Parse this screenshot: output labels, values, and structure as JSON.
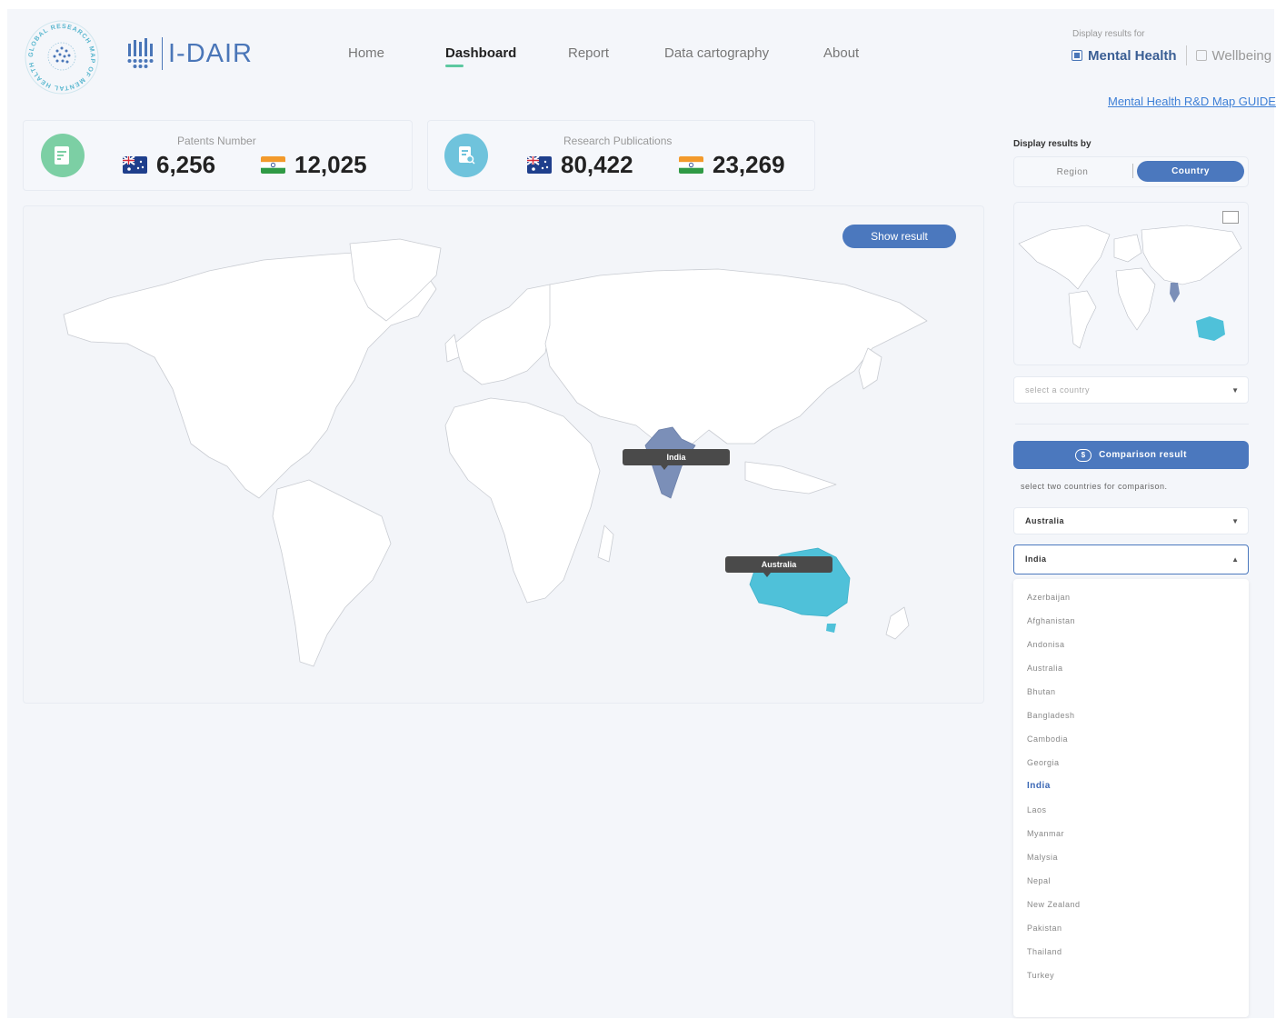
{
  "brand": {
    "name": "I-DAIR",
    "seal_text": "GLOBAL RESEARCH MAP OF MENTAL HEALTH"
  },
  "nav": {
    "items": [
      "Home",
      "Dashboard",
      "Report",
      "Data cartography",
      "About"
    ],
    "active": "Dashboard"
  },
  "display_for": {
    "label": "Display results for",
    "options": [
      {
        "label": "Mental Health",
        "checked": true
      },
      {
        "label": "Wellbeing",
        "checked": false
      }
    ]
  },
  "guide_link": "Mental Health R&D Map GUIDE",
  "stats": {
    "patents": {
      "label": "Patents Number",
      "australia": "6,256",
      "india": "12,025"
    },
    "publications": {
      "label": "Research Publications",
      "australia": "80,422",
      "india": "23,269"
    }
  },
  "map": {
    "show_result": "Show result",
    "tooltips": [
      "India",
      "Australia"
    ],
    "colors": {
      "india": "#7b8fb8",
      "australia": "#4fc1d9",
      "land": "#ffffff",
      "border": "#c9ccd2"
    }
  },
  "sidebar": {
    "display_by_label": "Display results by",
    "segments": [
      "Region",
      "Country"
    ],
    "active_segment": "Country",
    "country_select_placeholder": "select a country",
    "comparison_button": "Comparison result",
    "comparison_hint": "select two countries for comparison.",
    "compare_first": "Australia",
    "compare_second": "India",
    "dropdown_options": [
      "Azerbaijan",
      "Afghanistan",
      "Andonisa",
      "Australia",
      "Bhutan",
      "Bangladesh",
      "Cambodia",
      "Georgia",
      "India",
      "Laos",
      "Myanmar",
      "Malysia",
      "Nepal",
      "New Zealand",
      "Pakistan",
      "Thailand",
      "Turkey"
    ],
    "dropdown_selected": "India"
  },
  "colors": {
    "accent": "#4b78be",
    "nav_underline": "#5cc8a0",
    "patent_icon": "#7ccfa4",
    "publication_icon": "#6fc3dc"
  }
}
